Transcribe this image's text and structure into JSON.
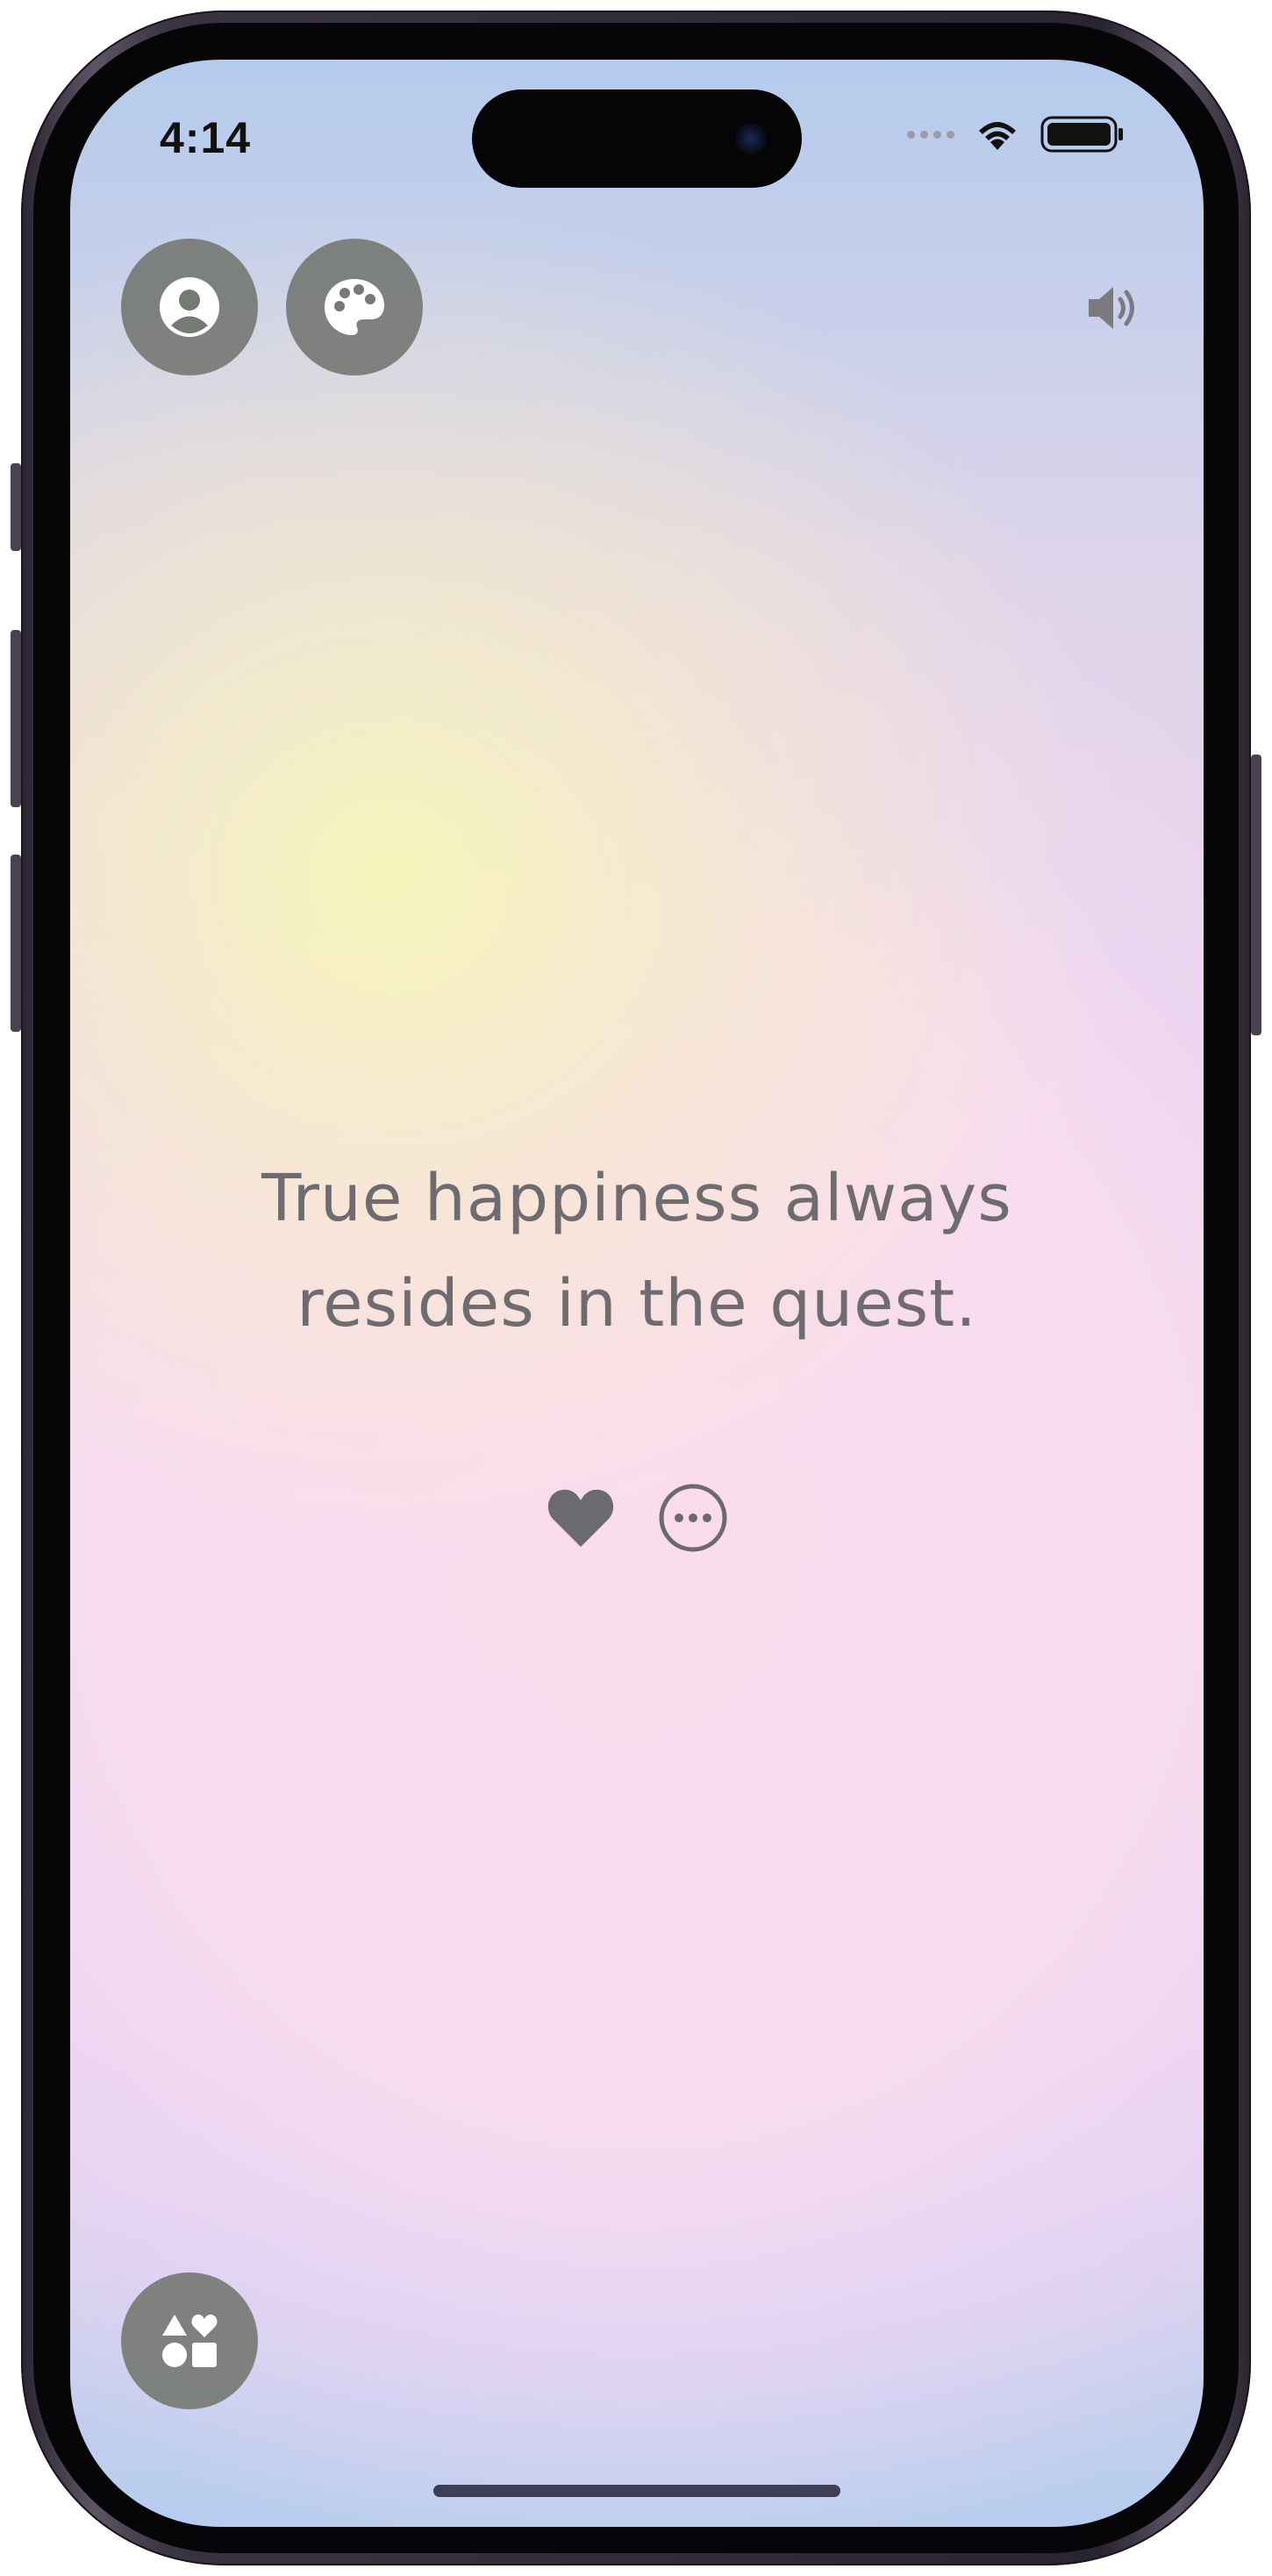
{
  "status_bar": {
    "time": "4:14"
  },
  "toolbar": {
    "profile_icon": "person-circle-icon",
    "themes_icon": "palette-icon",
    "sound_icon": "speaker-wave-icon",
    "categories_icon": "shapes-icon"
  },
  "quote": {
    "line1": "True happiness always",
    "line2": "resides in the quest."
  },
  "actions": {
    "like_icon": "heart-icon",
    "more_icon": "more-icon"
  },
  "colors": {
    "button_bg": "#767a74",
    "quote_text": "#6e6c70",
    "icon_gray": "#6b6a6e"
  }
}
